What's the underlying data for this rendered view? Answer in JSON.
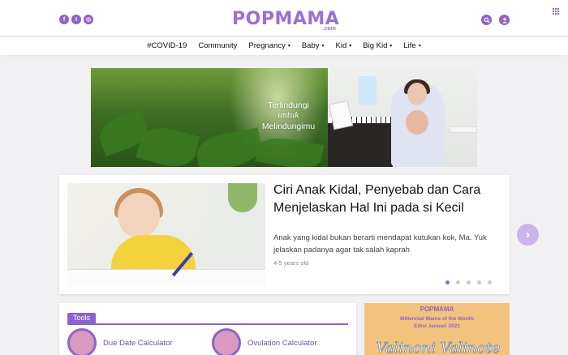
{
  "header": {
    "social": [
      {
        "icon": "facebook-icon",
        "glyph": "f"
      },
      {
        "icon": "twitter-icon",
        "glyph": "t"
      },
      {
        "icon": "instagram-icon",
        "glyph": "◎"
      }
    ],
    "logo_main": "POPMAMA",
    "logo_sub": ".com",
    "accent_color": "#8e63c9"
  },
  "nav": {
    "items": [
      {
        "label": "#COVID-19",
        "dropdown": false
      },
      {
        "label": "Community",
        "dropdown": false
      },
      {
        "label": "Pregnancy",
        "dropdown": true
      },
      {
        "label": "Baby",
        "dropdown": true
      },
      {
        "label": "Kid",
        "dropdown": true
      },
      {
        "label": "Big Kid",
        "dropdown": true
      },
      {
        "label": "Life",
        "dropdown": true
      }
    ],
    "caret": "▾"
  },
  "banner": {
    "line1": "Terlindungi",
    "line2": "untuk",
    "line3": "Melindungimu"
  },
  "featured": {
    "title": "Ciri Anak Kidal, Penyebab dan Cara Menjelaskan Hal Ini pada si Kecil",
    "description": "Anak yang kidal bukan berarti mendapat kutukan kok, Ma. Yuk jelaskan padanya agar tak salah kaprah",
    "tag": "4-5 years old",
    "slides": 5,
    "active_slide": 1,
    "next_glyph": "›"
  },
  "tools": {
    "label": "Tools",
    "items": [
      {
        "label": "Due Date Calculator",
        "icon": "pregnant-woman-icon"
      },
      {
        "label": "Ovulation Calculator",
        "icon": "ovulation-icon"
      }
    ]
  },
  "promo": {
    "brand": "POPMAMA",
    "line1": "Millennial Mama of the Month",
    "line2": "Edisi Januari 2021",
    "script": "Valinoni Valinote"
  }
}
